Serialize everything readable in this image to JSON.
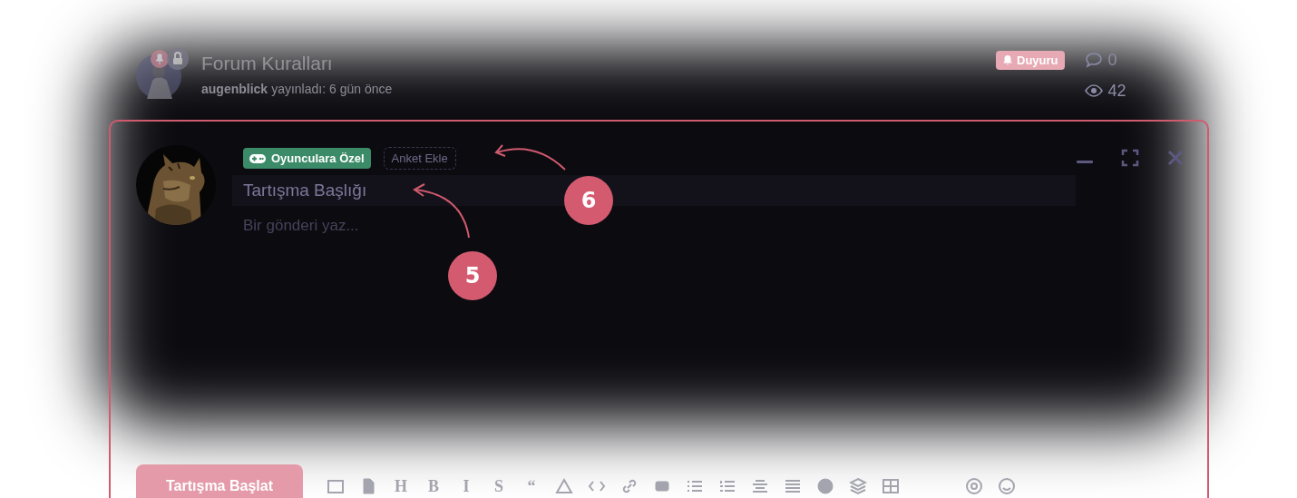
{
  "post": {
    "title": "Forum Kuralları",
    "author": "augenblick",
    "meta": "yayınladı: 6 gün önce",
    "badge": "Duyuru",
    "replies": "0",
    "views": "42"
  },
  "composer": {
    "tags": [
      {
        "label": "Oyunculara Özel",
        "kind": "tag"
      },
      {
        "label": "Anket Ekle",
        "kind": "button"
      }
    ],
    "title_value": "Tartışma Başlığı",
    "body_placeholder": "Bir gönderi yaz...",
    "submit": "Tartışma Başlat",
    "toolbar_glyphs": [
      "H",
      "B",
      "I",
      "S",
      "“"
    ]
  },
  "callouts": [
    {
      "label": "5"
    },
    {
      "label": "6"
    }
  ]
}
